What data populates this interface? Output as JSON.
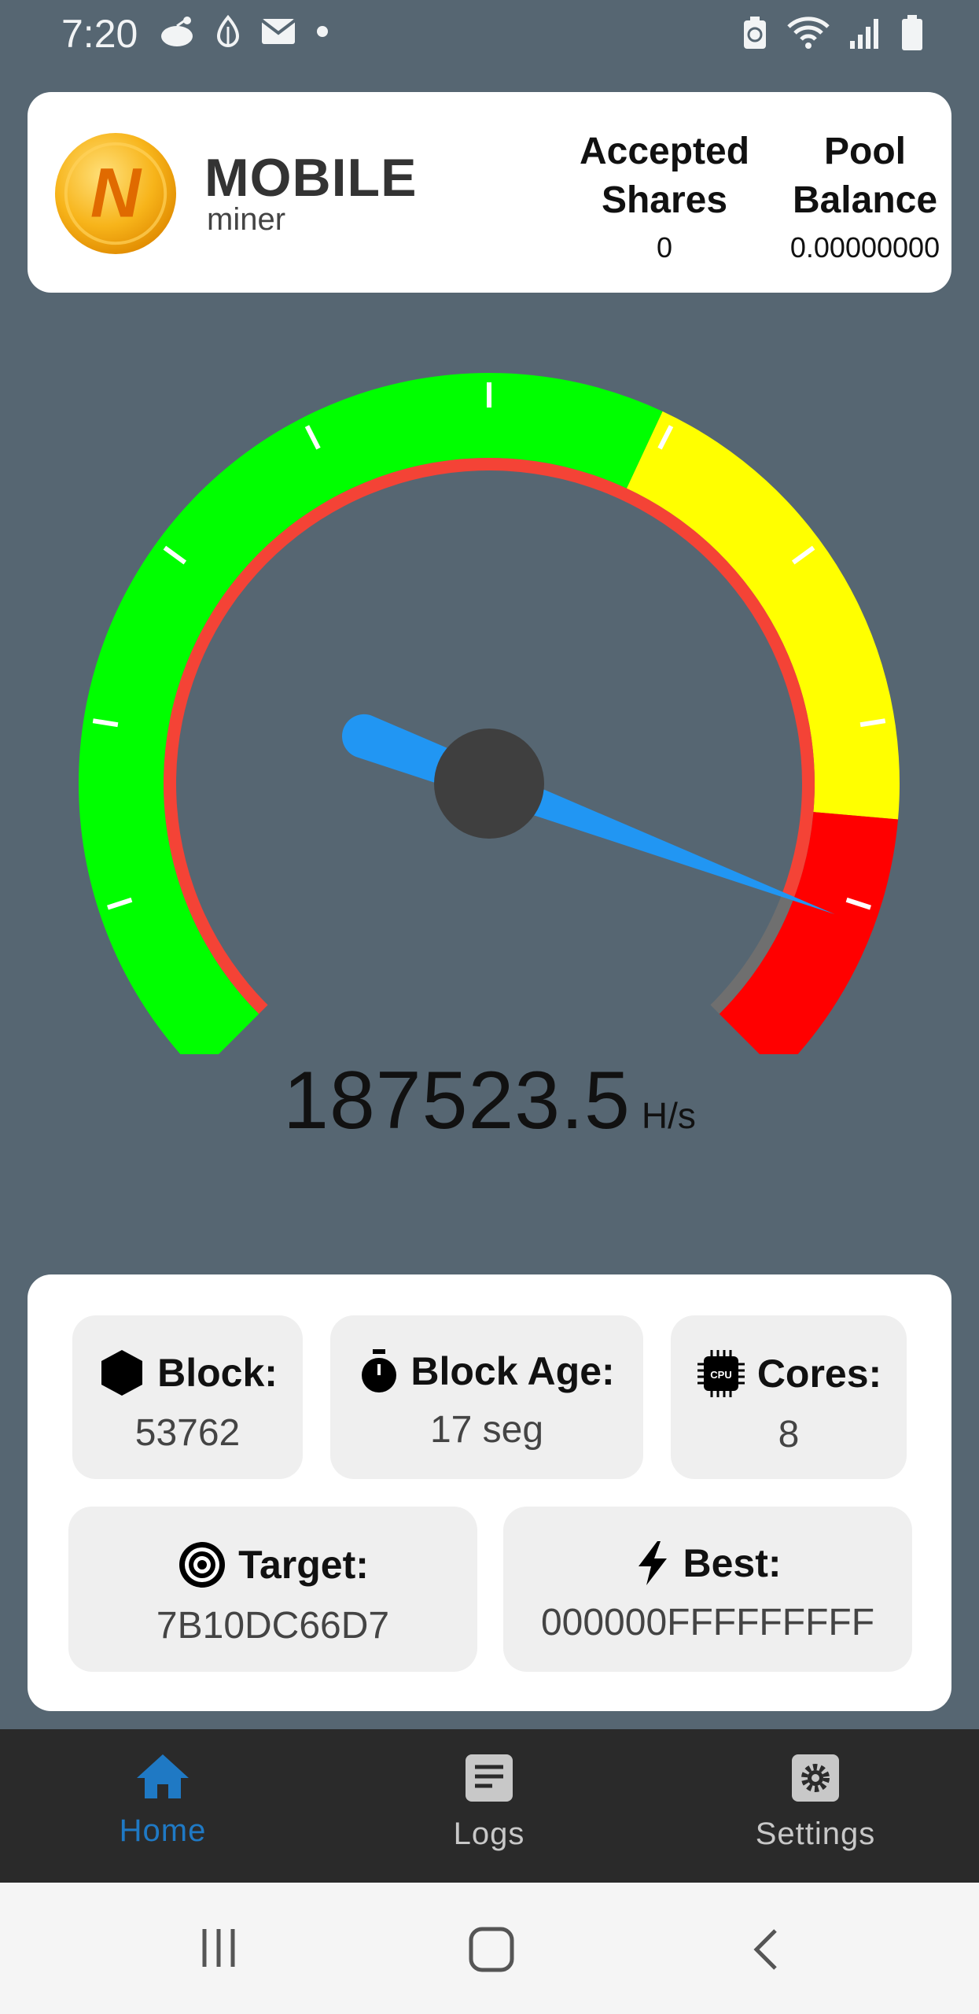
{
  "status_bar": {
    "time": "7:20",
    "left_icons": [
      "reddit-icon",
      "droplet-icon",
      "mail-icon",
      "dot-icon"
    ],
    "right_icons": [
      "battery-saver-icon",
      "wifi-icon",
      "signal-icon",
      "battery-icon"
    ]
  },
  "header": {
    "logo_letter": "N",
    "brand_title": "MOBILE",
    "brand_sub": "miner",
    "accepted_label": "Accepted\nShares",
    "accepted_value": "0",
    "balance_label": "Pool\nBalance",
    "balance_value": "0.00000000"
  },
  "gauge": {
    "value_fraction": 0.91,
    "zones": [
      {
        "name": "green",
        "color": "#00ff00"
      },
      {
        "name": "yellow",
        "color": "#ffff00"
      },
      {
        "name": "red",
        "color": "#ff0000"
      }
    ],
    "inner_ring_color": "#f44336",
    "needle_color": "#2196f3"
  },
  "hashrate": {
    "value": "187523.5",
    "unit": "H/s"
  },
  "info": {
    "block_label": "Block:",
    "block_value": "53762",
    "age_label": "Block Age:",
    "age_value": "17 seg",
    "cores_label": "Cores:",
    "cores_value": "8",
    "cpu_chip_text": "CPU",
    "target_label": "Target:",
    "target_value": "7B10DC66D7",
    "best_label": "Best:",
    "best_value": "000000FFFFFFFFF"
  },
  "nav": {
    "home": "Home",
    "logs": "Logs",
    "settings": "Settings",
    "active_color": "#1f79c4"
  }
}
